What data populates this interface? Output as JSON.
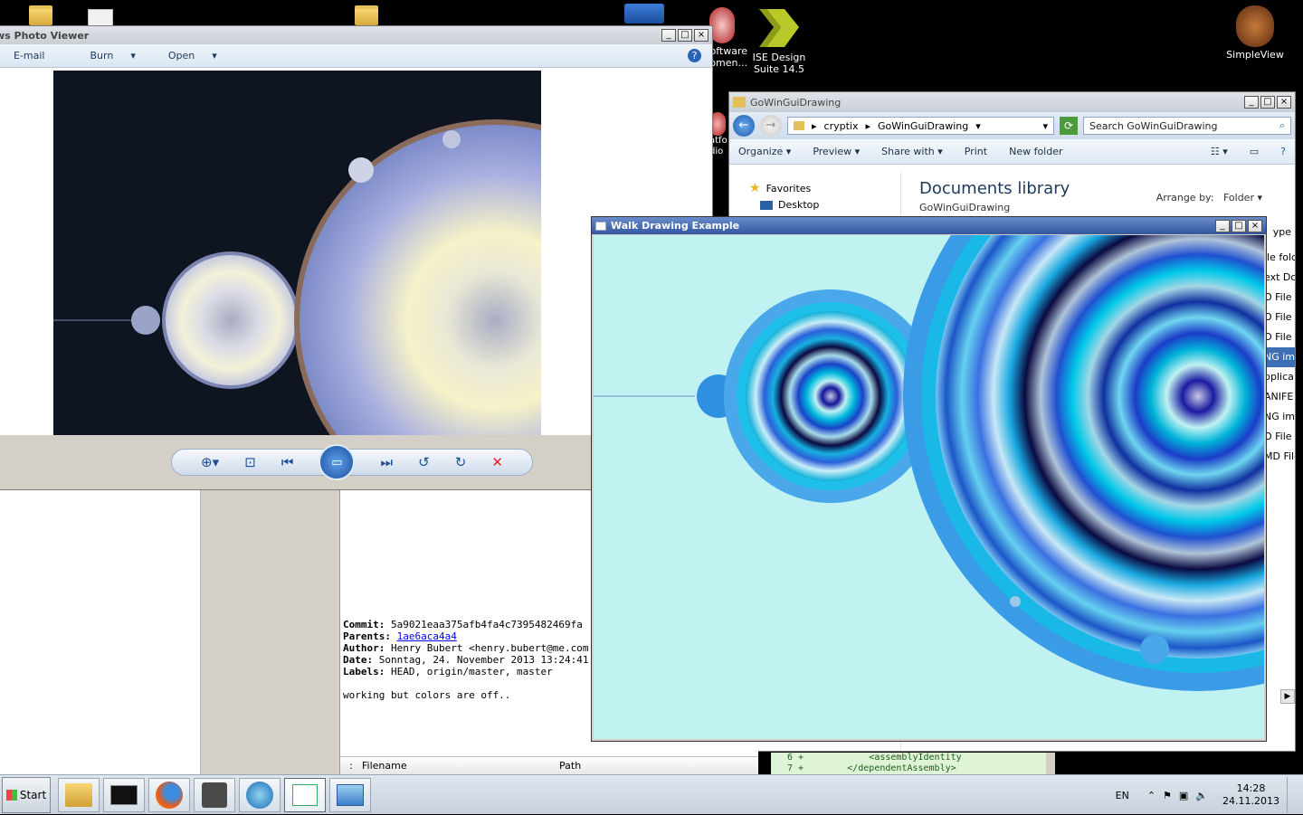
{
  "desktop": {
    "icons": [
      {
        "label": "oftware omen..."
      },
      {
        "label": "ISE Design Suite 14.5"
      },
      {
        "label": "SimpleView"
      },
      {
        "label": "atfo dio"
      }
    ]
  },
  "photo_viewer": {
    "title": "ws Photo Viewer",
    "menu": {
      "email": "E-mail",
      "burn": "Burn",
      "open": "Open"
    },
    "controls": {
      "zoom": "zoom-icon",
      "fit": "fit-icon",
      "prev": "previous-icon",
      "slideshow": "slideshow-icon",
      "next": "next-icon",
      "rotate_ccw": "rotate-ccw-icon",
      "rotate_cw": "rotate-cw-icon",
      "delete": "delete-icon"
    }
  },
  "git": {
    "commit_label": "Commit:",
    "commit_value": "5a9021eaa375afb4fa4c7395482469fa",
    "parents_label": "Parents:",
    "parents_value": "1ae6aca4a4",
    "author_label": "Author:",
    "author_value": "Henry Bubert <henry.bubert@me.com",
    "date_label": "Date:",
    "date_value": "Sonntag, 24. November 2013 13:24:41",
    "labels_label": "Labels:",
    "labels_value": "HEAD, origin/master, master",
    "message": "working but colors are off..",
    "files_cols": {
      "filename": "Filename",
      "path": "Path"
    }
  },
  "explorer": {
    "title": "GoWinGuiDrawing",
    "breadcrumb": [
      "cryptix",
      "GoWinGuiDrawing"
    ],
    "search_placeholder": "Search GoWinGuiDrawing",
    "commands": {
      "organize": "Organize",
      "preview": "Preview",
      "share": "Share with",
      "print": "Print",
      "new_folder": "New folder"
    },
    "nav": {
      "favorites": "Favorites",
      "desktop": "Desktop"
    },
    "library_title": "Documents library",
    "library_sub": "GoWinGuiDrawing",
    "arrange_label": "Arrange by:",
    "arrange_value": "Folder",
    "type_header": "ype",
    "types": [
      "ile fold",
      "ext Do",
      "O File",
      "O File",
      "O File",
      "NG ima",
      "pplica",
      "ANIFE",
      "NG ima",
      "O File",
      "MD File"
    ]
  },
  "walk_window": {
    "title": "Walk Drawing Example"
  },
  "diff": {
    "line1": "6 +            <assemblyIdentity",
    "line2": "7 +        </dependentAssembly>"
  },
  "taskbar": {
    "start": "Start",
    "tray": {
      "lang": "EN",
      "time": "14:28",
      "date": "24.11.2013"
    }
  }
}
